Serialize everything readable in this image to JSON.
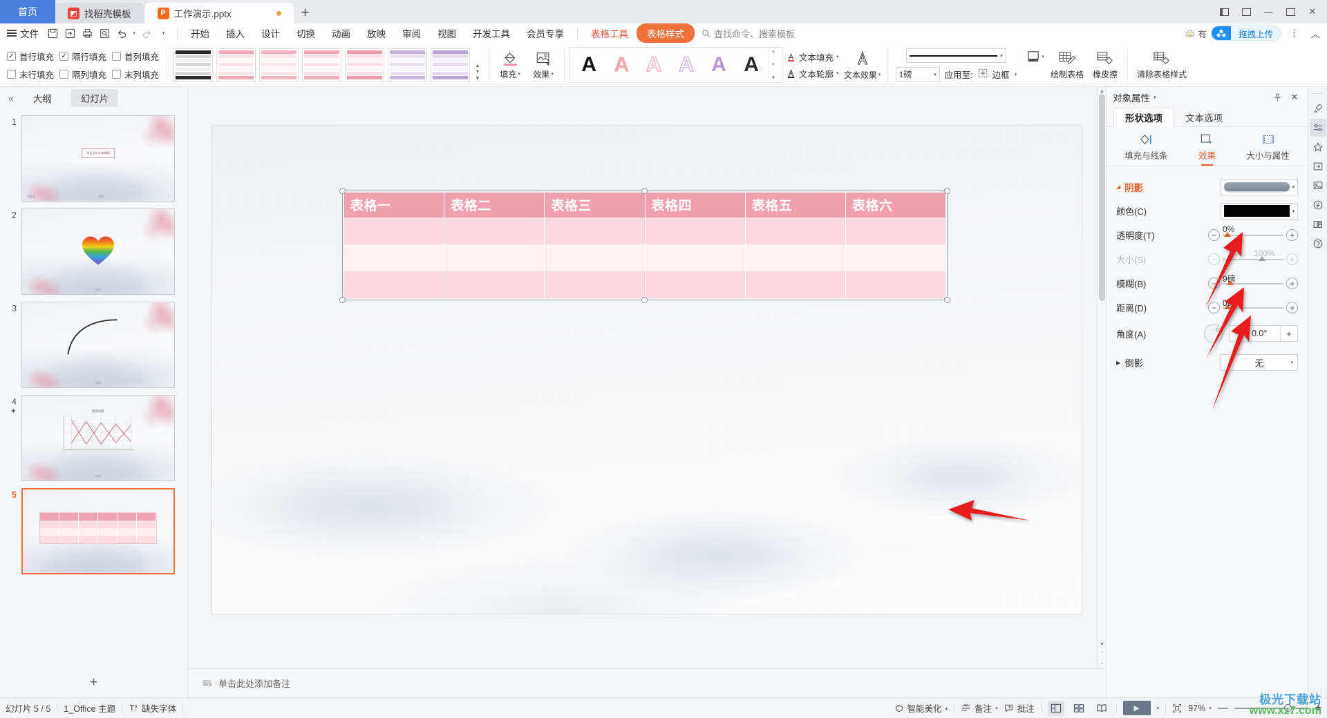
{
  "titlebar": {
    "home_tab": "首页",
    "tabs": [
      {
        "label": "找稻壳模板",
        "icon": "wps-template-icon",
        "state": "inactive"
      },
      {
        "label": "工作演示.pptx",
        "icon": "powerpoint-icon",
        "state": "active",
        "modified": true
      }
    ],
    "new_tab": "+",
    "minimize": "—",
    "maximize": "▢",
    "close": "✕"
  },
  "menubar": {
    "file": "文件",
    "icons": [
      "save-icon",
      "save-as-icon",
      "print-icon",
      "print-preview-icon",
      "undo-icon",
      "redo-icon",
      "customize-icon"
    ],
    "items": [
      "开始",
      "插入",
      "设计",
      "切换",
      "动画",
      "放映",
      "审阅",
      "视图",
      "开发工具",
      "会员专享"
    ],
    "tool_tab": "表格工具",
    "active_tab": "表格样式",
    "search_placeholder": "查找命令、搜索模板",
    "cloud_label": "有",
    "upload_label": "拖拽上传",
    "more": "⋮",
    "collapse": "︿"
  },
  "ribbon": {
    "checkboxes": [
      {
        "label": "首行填充",
        "checked": true
      },
      {
        "label": "隔行填充",
        "checked": true
      },
      {
        "label": "首列填充",
        "checked": false
      },
      {
        "label": "末行填充",
        "checked": false
      },
      {
        "label": "隔列填充",
        "checked": false
      },
      {
        "label": "末列填充",
        "checked": false
      }
    ],
    "fill_label": "填充",
    "effect_label": "效果",
    "text_fill": "文本填充",
    "text_outline": "文本轮廓",
    "text_effect": "文本效果",
    "line_width": "1磅",
    "apply_to": "应用至:",
    "border_label": "边框",
    "draw_table": "绘制表格",
    "eraser": "橡皮擦",
    "clear_style": "清除表格样式",
    "wordart_letter": "A"
  },
  "thumbnails": {
    "collapse": "«",
    "tab_outline": "大纲",
    "tab_slides": "幻灯片",
    "slides": [
      {
        "number": "1",
        "type": "title",
        "title_text": "单击此处文本编辑",
        "subtitle": "请编辑",
        "footer": "副图",
        "page": "1",
        "selected": false
      },
      {
        "number": "2",
        "type": "heart",
        "footer": "副图",
        "selected": false
      },
      {
        "number": "3",
        "type": "curve",
        "footer": "副图",
        "selected": false
      },
      {
        "number": "4",
        "type": "chart",
        "footer": "副图",
        "selected": false,
        "animated": true
      },
      {
        "number": "5",
        "type": "table",
        "selected": true
      }
    ],
    "add_slide": "+"
  },
  "slide": {
    "table": {
      "headers": [
        "表格一",
        "表格二",
        "表格三",
        "表格四",
        "表格五",
        "表格六"
      ],
      "body_rows": [
        [
          "",
          "",
          "",
          "",
          "",
          ""
        ],
        [
          "",
          "",
          "",
          "",
          "",
          ""
        ],
        [
          "",
          "",
          "",
          "",
          "",
          ""
        ]
      ],
      "header_bg": "#f0a0b0",
      "row_alt_bg": "#fbd9e0",
      "row_bg": "#fdf0f3"
    },
    "quick_action": "lightbulb-icon"
  },
  "notes": {
    "placeholder": "单击此处添加备注"
  },
  "right_panel": {
    "title": "对象属性",
    "pin": "pin-icon",
    "close": "✕",
    "tabs": [
      {
        "label": "形状选项",
        "active": true
      },
      {
        "label": "文本选项",
        "active": false
      }
    ],
    "subtabs": [
      {
        "label": "填充与线条",
        "icon": "fill-line-icon",
        "active": false
      },
      {
        "label": "效果",
        "icon": "effects-icon",
        "active": true
      },
      {
        "label": "大小与属性",
        "icon": "size-properties-icon",
        "active": false
      }
    ],
    "shadow": {
      "section_title": "阴影",
      "preset_label": "",
      "color_label": "颜色(C)",
      "color_value": "#000000",
      "transparency_label": "透明度(T)",
      "transparency_value": "0%",
      "size_label": "大小(S)",
      "size_value": "100%",
      "size_disabled": true,
      "blur_label": "模糊(B)",
      "blur_value": "9磅",
      "distance_label": "距离(D)",
      "distance_value": "0磅",
      "angle_label": "角度(A)",
      "angle_value": "0.0°"
    },
    "reflection": {
      "section_title": "倒影",
      "value": "无"
    }
  },
  "rail": {
    "icons": [
      "rocket-icon",
      "properties-icon",
      "star-effects-icon",
      "slide-transfer-icon",
      "material-icon",
      "idea-icon",
      "document-search-icon",
      "help-icon"
    ],
    "active_index": 1
  },
  "status": {
    "slide_count": "幻灯片 5 / 5",
    "theme": "1_Office 主题",
    "missing_font": "缺失字体",
    "beautify": "智能美化",
    "notes": "备注",
    "comments": "批注",
    "views": [
      "normal-view-icon",
      "slide-sorter-icon",
      "reading-view-icon"
    ],
    "active_view": 0,
    "play": "▶",
    "fit_icon": "fit-to-window-icon",
    "zoom": "97%",
    "zoom_out": "—",
    "zoom_in": "+"
  },
  "watermark": {
    "line1": "极光下载站",
    "line2": "www.xz7.com"
  },
  "colors": {
    "accent_orange": "#f2703a",
    "accent_blue": "#4a7dde",
    "table_pink": "#f0a0b0",
    "arrow_red": "#e81d1d"
  }
}
